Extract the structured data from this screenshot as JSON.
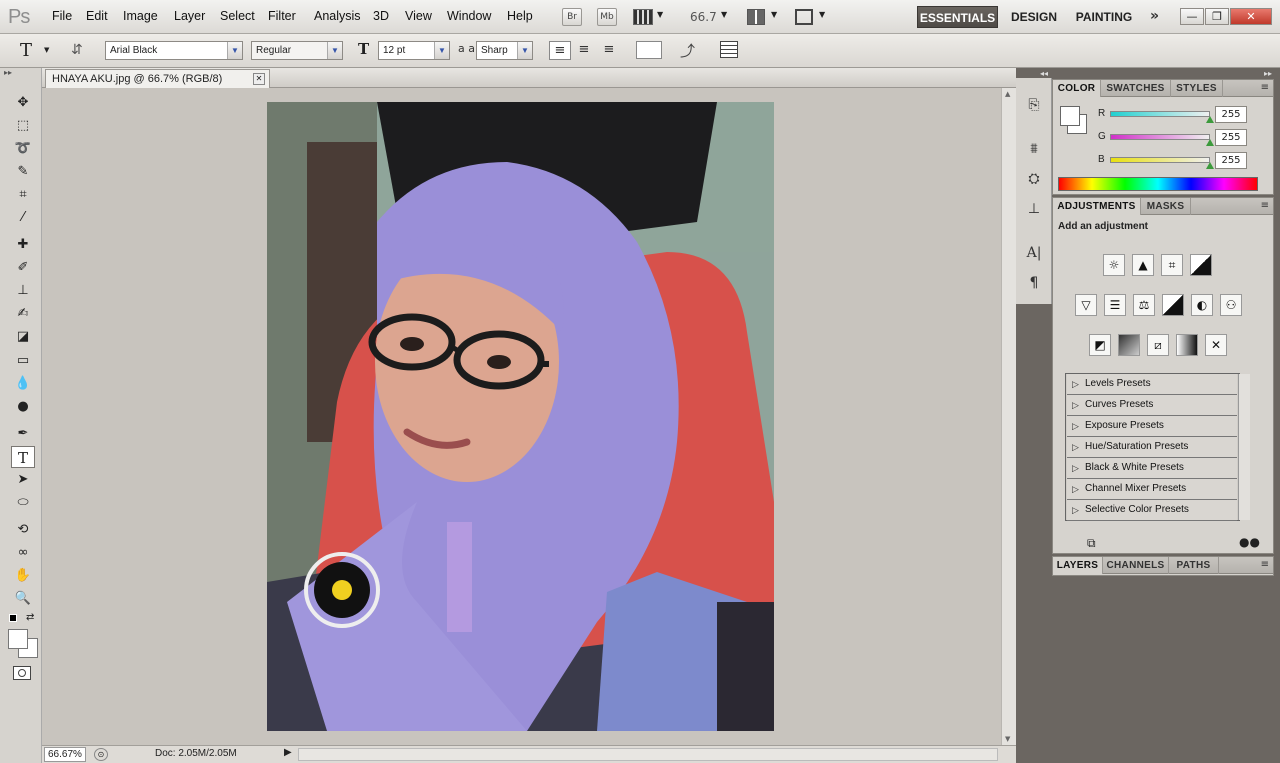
{
  "app": {
    "logo": "Ps"
  },
  "menu": [
    "File",
    "Edit",
    "Image",
    "Layer",
    "Select",
    "Filter",
    "Analysis",
    "3D",
    "View",
    "Window",
    "Help"
  ],
  "appbar": {
    "br": "Br",
    "mb": "Mb",
    "zoom": "66.7"
  },
  "workspaces": {
    "active": "ESSENTIALS",
    "design": "DESIGN",
    "painting": "PAINTING"
  },
  "options": {
    "tool_glyph": "T",
    "font_family": "Arial Black",
    "font_style": "Regular",
    "font_size": "12 pt",
    "aa_label": "a a",
    "antialias": "Sharp"
  },
  "document": {
    "tab_title": "HNAYA AKU.jpg @ 66.7% (RGB/8)"
  },
  "status": {
    "zoom": "66.67%",
    "doc": "Doc: 2.05M/2.05M"
  },
  "color_panel": {
    "tabs": [
      "COLOR",
      "SWATCHES",
      "STYLES"
    ],
    "channels": [
      {
        "label": "R",
        "value": "255",
        "color": "#28c8c8"
      },
      {
        "label": "G",
        "value": "255",
        "color": "#d040c8"
      },
      {
        "label": "B",
        "value": "255",
        "color": "#e8e020"
      }
    ]
  },
  "adjust_panel": {
    "tabs": [
      "ADJUSTMENTS",
      "MASKS"
    ],
    "heading": "Add an adjustment",
    "presets": [
      "Levels Presets",
      "Curves Presets",
      "Exposure Presets",
      "Hue/Saturation Presets",
      "Black & White Presets",
      "Channel Mixer Presets",
      "Selective Color Presets"
    ]
  },
  "layers_panel": {
    "tabs": [
      "LAYERS",
      "CHANNELS",
      "PATHS"
    ]
  }
}
